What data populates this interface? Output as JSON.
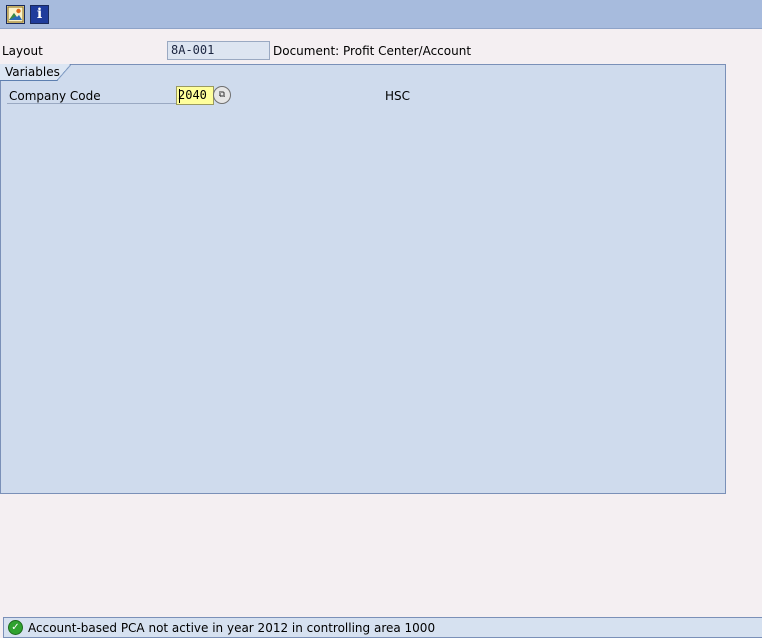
{
  "toolbar": {
    "image_icon": "picture-icon",
    "info_icon": "info-icon",
    "info_glyph": "i"
  },
  "header": {
    "layout_label": "Layout",
    "layout_value": "8A-001",
    "layout_description": "Document: Profit Center/Account"
  },
  "variables": {
    "tab_label": "Variables",
    "company_code_label": "Company Code",
    "company_code_value": "2040",
    "company_code_text": "HSC",
    "f4_icon": "value-help-icon",
    "f4_glyph": "⧉"
  },
  "status": {
    "icon": "check-circle-icon",
    "icon_glyph": "✓",
    "message": "Account-based PCA not active in year 2012 in controlling area 1000"
  },
  "colors": {
    "toolbar": "#a7bbdd",
    "panel": "#cfdbed",
    "input_highlight": "#ffff9c",
    "status_ok": "#2fa22f"
  }
}
